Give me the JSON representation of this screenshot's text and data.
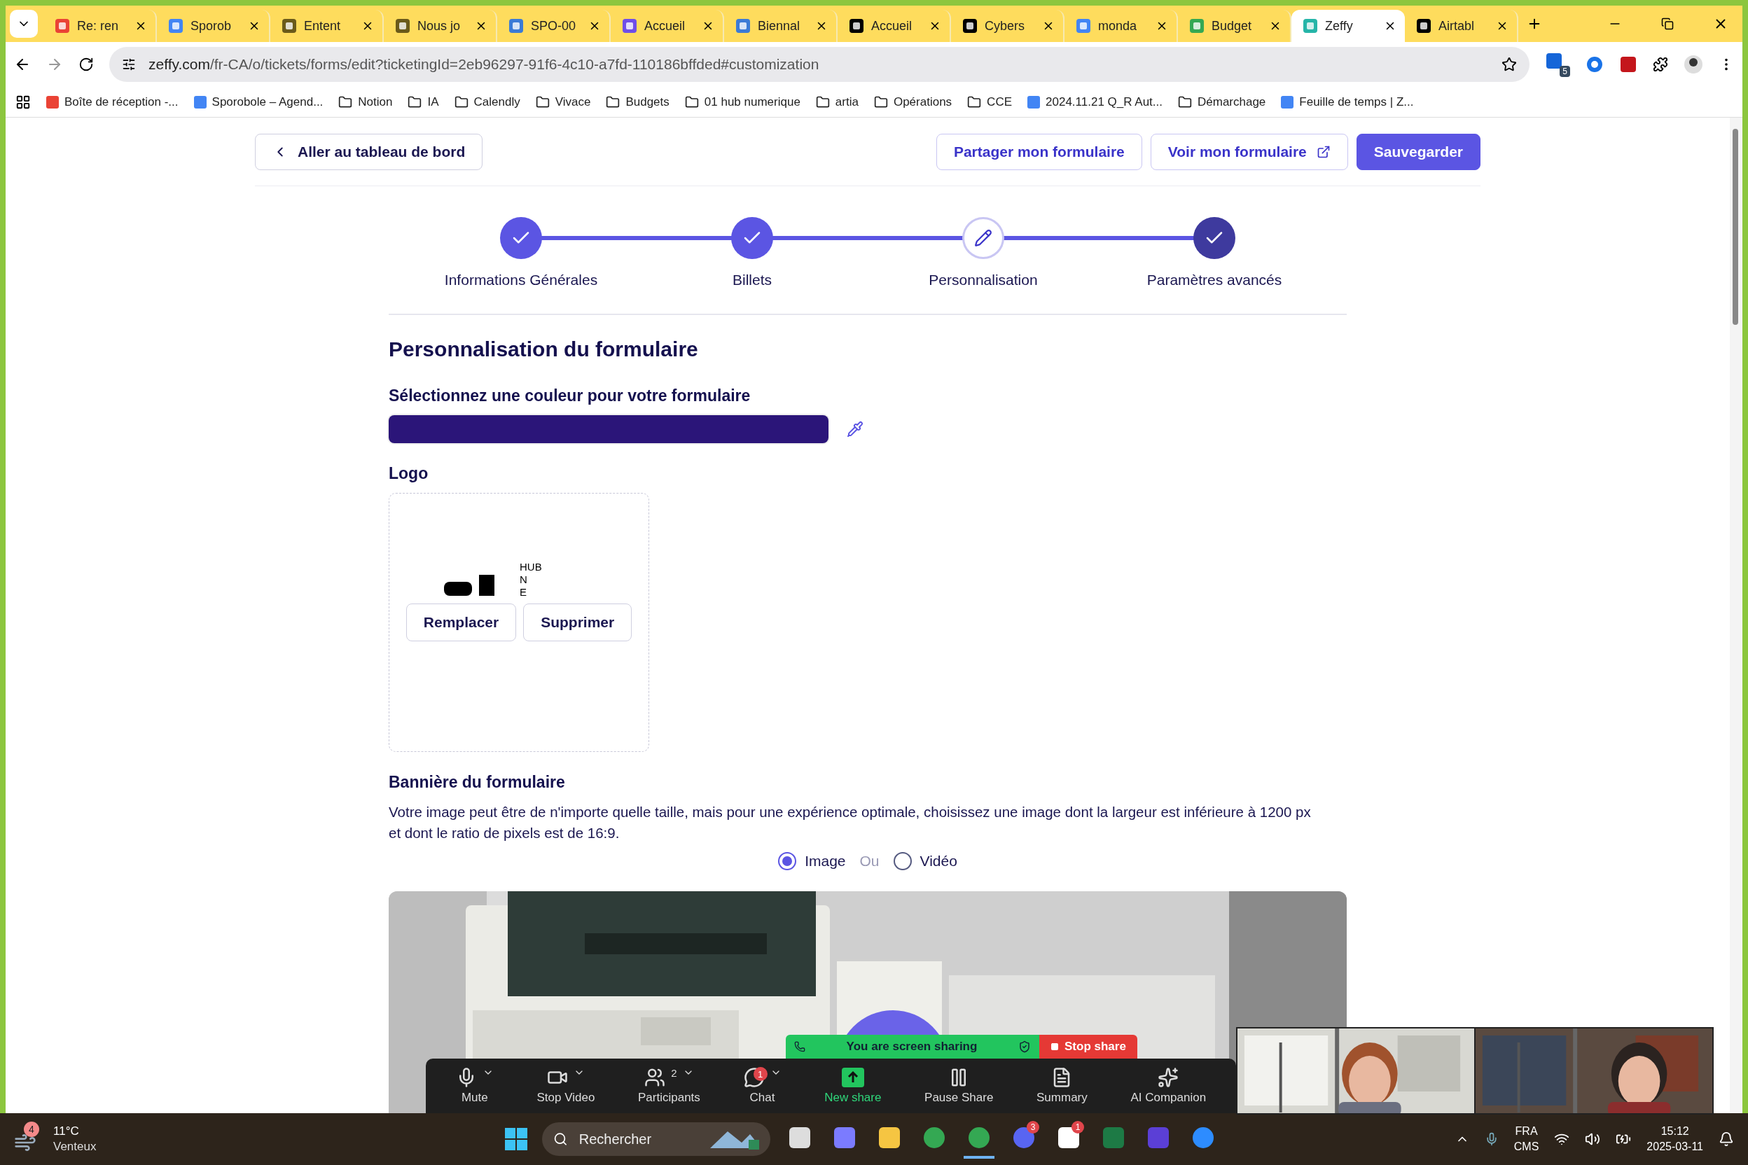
{
  "browser": {
    "tabs": [
      {
        "title": "Re: ren",
        "selected": false
      },
      {
        "title": "Sporob",
        "selected": false
      },
      {
        "title": "Entent",
        "selected": false
      },
      {
        "title": "Nous jo",
        "selected": false
      },
      {
        "title": "SPO-00",
        "selected": false
      },
      {
        "title": "Accueil",
        "selected": false
      },
      {
        "title": "Biennal",
        "selected": false
      },
      {
        "title": "Accueil",
        "selected": false
      },
      {
        "title": "Cybers",
        "selected": false
      },
      {
        "title": "monda",
        "selected": false
      },
      {
        "title": "Budget",
        "selected": false
      },
      {
        "title": "Zeffy",
        "selected": true
      },
      {
        "title": "Airtabl",
        "selected": false
      }
    ],
    "url": {
      "host": "zeffy.com",
      "path": "/fr-CA/o/tickets/forms/edit?ticketingId=2eb96297-91f6-4c10-a7fd-110186bffded#customization"
    },
    "extension_badge": "5",
    "bookmarks": [
      {
        "label": "Boîte de réception -...",
        "kind": "site"
      },
      {
        "label": "Sporobole – Agend...",
        "kind": "site"
      },
      {
        "label": "Notion",
        "kind": "folder"
      },
      {
        "label": "IA",
        "kind": "folder"
      },
      {
        "label": "Calendly",
        "kind": "folder"
      },
      {
        "label": "Vivace",
        "kind": "folder"
      },
      {
        "label": "Budgets",
        "kind": "folder"
      },
      {
        "label": "01 hub numerique",
        "kind": "folder"
      },
      {
        "label": "artia",
        "kind": "folder"
      },
      {
        "label": "Opérations",
        "kind": "folder"
      },
      {
        "label": "CCE",
        "kind": "folder"
      },
      {
        "label": "2024.11.21 Q_R Aut...",
        "kind": "site"
      },
      {
        "label": "Démarchage",
        "kind": "folder"
      },
      {
        "label": "Feuille de temps | Z...",
        "kind": "site"
      }
    ]
  },
  "page": {
    "back_button": "Aller au tableau de bord",
    "actions": [
      {
        "label": "Partager mon formulaire",
        "kind": "outline"
      },
      {
        "label": "Voir mon formulaire",
        "kind": "external"
      },
      {
        "label": "Sauvegarder",
        "kind": "primary"
      }
    ],
    "steps": [
      {
        "label": "Informations Générales",
        "completed": true,
        "current": false,
        "emphasized": false
      },
      {
        "label": "Billets",
        "completed": true,
        "current": false,
        "emphasized": false
      },
      {
        "label": "Personnalisation",
        "completed": false,
        "current": true,
        "emphasized": false
      },
      {
        "label": "Paramètres avancés",
        "completed": true,
        "current": false,
        "emphasized": true
      }
    ],
    "heading": "Personnalisation du formulaire",
    "color_section": {
      "label": "Sélectionnez une couleur pour votre formulaire",
      "color": "#2b1579"
    },
    "logo_section": {
      "label": "Logo",
      "logo_text": [
        "HUB",
        "N",
        "E"
      ],
      "buttons": [
        "Remplacer",
        "Supprimer"
      ]
    },
    "banner_section": {
      "label": "Bannière du formulaire",
      "description": "Votre image peut être de n'importe quelle taille, mais pour une expérience optimale, choisissez une image dont la largeur est inférieure à 1200 px et dont le ratio de pixels est de 16:9.",
      "options": [
        {
          "label": "Image",
          "selected": true
        },
        {
          "label": "Vidéo",
          "selected": false
        }
      ],
      "separator": "Ou"
    }
  },
  "zoom": {
    "banner": "You are screen sharing",
    "stop_button": "Stop share",
    "controls": [
      {
        "label": "Mute",
        "kind": "mic",
        "caret": true
      },
      {
        "label": "Stop Video",
        "kind": "video",
        "caret": true
      },
      {
        "label": "Participants",
        "kind": "people",
        "caret": true,
        "count": "2"
      },
      {
        "label": "Chat",
        "kind": "chat",
        "caret": true,
        "badge": "1"
      },
      {
        "label": "New share",
        "kind": "share",
        "caret": false
      },
      {
        "label": "Pause Share",
        "kind": "pause",
        "caret": false
      },
      {
        "label": "Summary",
        "kind": "summary",
        "caret": false
      },
      {
        "label": "AI Companion",
        "kind": "ai",
        "caret": false
      }
    ]
  },
  "taskbar": {
    "weather": {
      "badge": "4",
      "temperature": "11°C",
      "condition": "Venteux"
    },
    "search": {
      "placeholder": "Rechercher"
    },
    "apps": [
      {
        "kind": "taskview"
      },
      {
        "kind": "copilot"
      },
      {
        "kind": "files"
      },
      {
        "kind": "chrome"
      },
      {
        "kind": "chrome",
        "active": true
      },
      {
        "kind": "discord",
        "badge": "3"
      },
      {
        "kind": "notion",
        "badge": "1"
      },
      {
        "kind": "excel"
      },
      {
        "kind": "g"
      },
      {
        "kind": "zoom"
      }
    ],
    "language": "FRA",
    "keyboard": "CMS",
    "time": "15:12",
    "date": "2025-03-11"
  }
}
